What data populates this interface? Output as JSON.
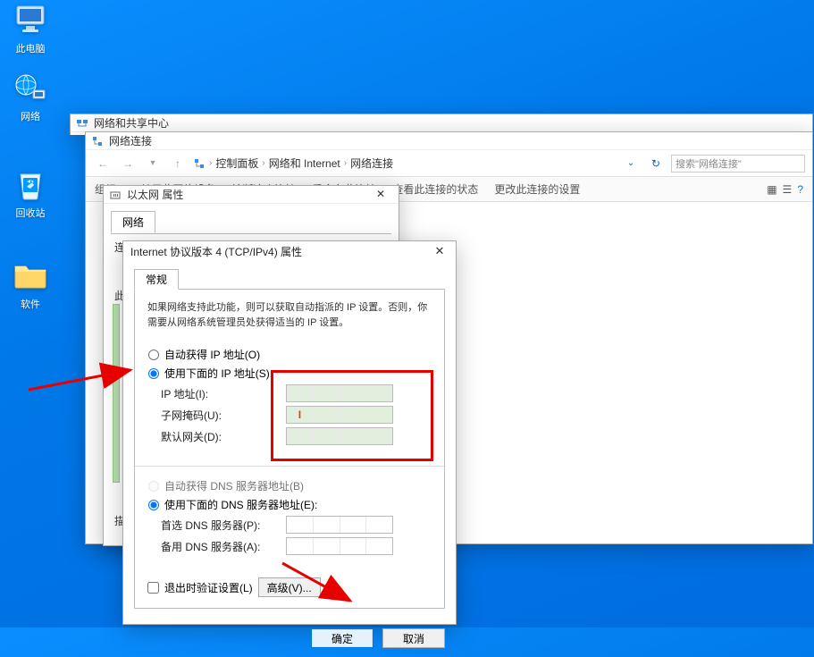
{
  "desktop": {
    "icons": [
      {
        "name": "this-pc",
        "label": "此电脑"
      },
      {
        "name": "network",
        "label": "网络"
      },
      {
        "name": "recycle-bin",
        "label": "回收站"
      },
      {
        "name": "software",
        "label": "软件"
      }
    ]
  },
  "win_nsc": {
    "title": "网络和共享中心"
  },
  "win_nc": {
    "title": "网络连接",
    "breadcrumb": [
      "控制面板",
      "网络和 Internet",
      "网络连接"
    ],
    "search_placeholder": "搜索\"网络连接\"",
    "toolbar": {
      "organize": "组织 ▾",
      "disable": "禁用此网络设备",
      "diagnose": "诊断这个连接",
      "rename": "重命名此连接",
      "status": "查看此连接的状态",
      "change": "更改此连接的设置"
    }
  },
  "win_eth": {
    "title": "以太网 属性",
    "tab": "网络",
    "partial_text_1": "连",
    "partial_text_2": "此",
    "partial_text_3": "描"
  },
  "win_tcpip": {
    "title": "Internet 协议版本 4 (TCP/IPv4) 属性",
    "tab": "常规",
    "description": "如果网络支持此功能，则可以获取自动指派的 IP 设置。否则，你需要从网络系统管理员处获得适当的 IP 设置。",
    "radio_auto_ip": "自动获得 IP 地址(O)",
    "radio_manual_ip": "使用下面的 IP 地址(S):",
    "label_ip": "IP 地址(I):",
    "label_mask": "子网掩码(U):",
    "label_gateway": "默认网关(D):",
    "radio_auto_dns": "自动获得 DNS 服务器地址(B)",
    "radio_manual_dns": "使用下面的 DNS 服务器地址(E):",
    "label_dns1": "首选 DNS 服务器(P):",
    "label_dns2": "备用 DNS 服务器(A):",
    "chk_validate": "退出时验证设置(L)",
    "btn_advanced": "高级(V)...",
    "btn_ok": "确定",
    "btn_cancel": "取消"
  }
}
